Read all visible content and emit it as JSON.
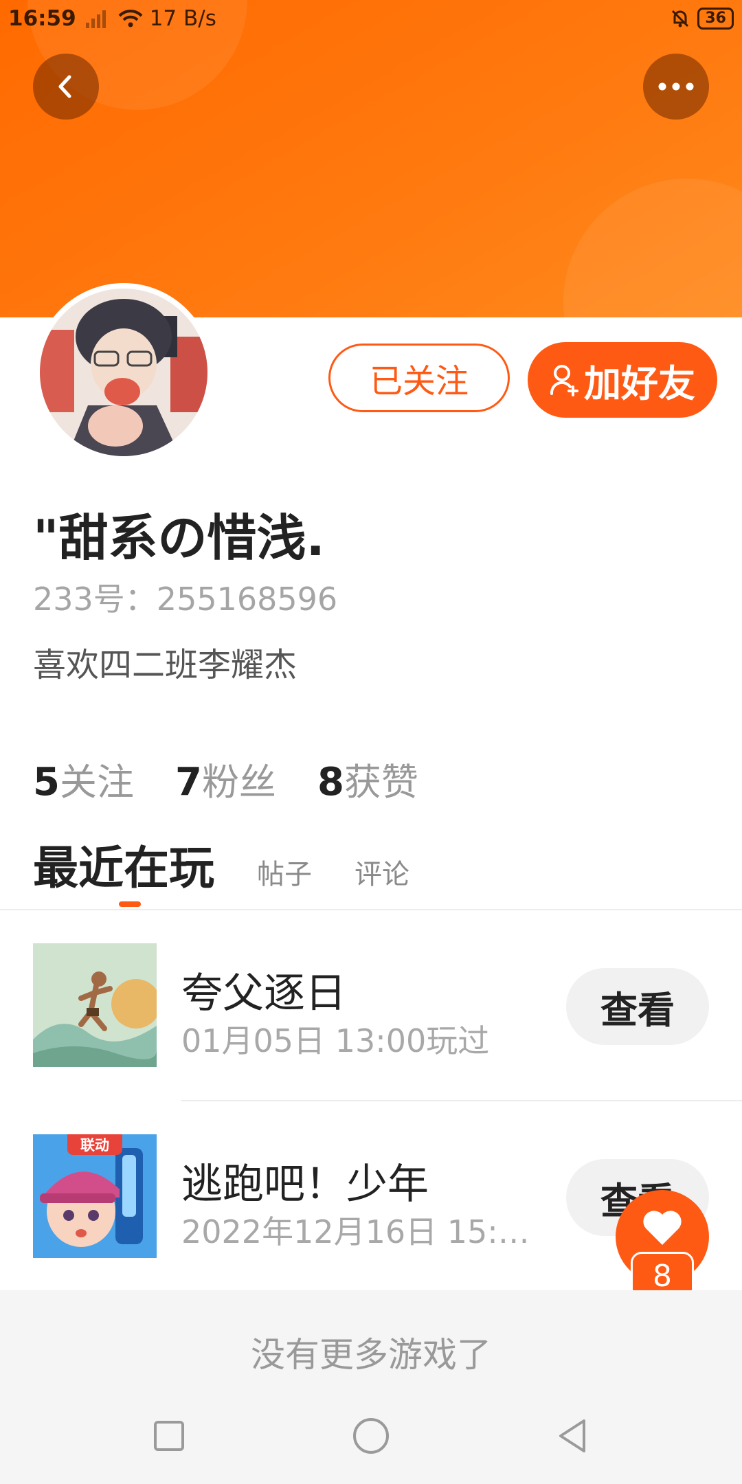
{
  "status_bar": {
    "time": "16:59",
    "network_speed": "17 B/s",
    "battery": "36"
  },
  "header": {
    "back_icon": "chevron-left-icon",
    "more_icon": "more-dots-icon",
    "color": "#ff6a00"
  },
  "profile": {
    "follow_label": "已关注",
    "add_friend_label": "加好友",
    "nickname": "\"甜系の惜浅.",
    "uid": "233号：255168596",
    "bio": "喜欢四二班李耀杰",
    "stats": [
      {
        "count": "5",
        "label": "关注"
      },
      {
        "count": "7",
        "label": "粉丝"
      },
      {
        "count": "8",
        "label": "获赞"
      }
    ]
  },
  "tabs": [
    {
      "label": "最近在玩",
      "active": true
    },
    {
      "label": "帖子",
      "active": false
    },
    {
      "label": "评论",
      "active": false
    }
  ],
  "games": [
    {
      "title": "夸父逐日",
      "played": "01月05日 13:00玩过",
      "action": "查看"
    },
    {
      "title": "逃跑吧！少年",
      "played": "2022年12月16日 15:1...",
      "action": "查看",
      "badge": "联动"
    }
  ],
  "like": {
    "count": "8",
    "icon": "heart-icon"
  },
  "footer_text": "没有更多游戏了",
  "accent_color": "#ff5a14"
}
